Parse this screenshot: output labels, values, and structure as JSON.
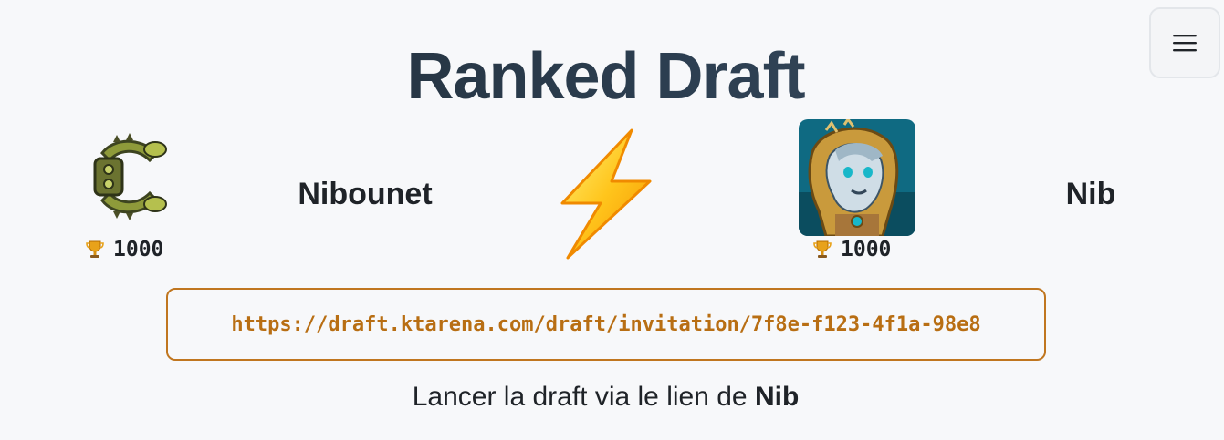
{
  "header": {
    "title": "Ranked Draft",
    "menu_icon": "hamburger-icon"
  },
  "players": [
    {
      "name": "Nibounet",
      "rating": "1000",
      "avatar": "mechanical-creature-icon"
    },
    {
      "name": "Nib",
      "rating": "1000",
      "avatar": "hooded-character-portrait"
    }
  ],
  "versus_icon": "lightning-bolt-icon",
  "invite": {
    "url": "https://draft.ktarena.com/draft/invitation/7f8e-f123-4f1a-98e8"
  },
  "launch": {
    "prefix": "Lancer la draft via le lien de ",
    "player": "Nib"
  },
  "colors": {
    "accent": "#c0761f",
    "link_text": "#b86e13",
    "title": "#2c3e50",
    "background": "#f7f8fa"
  }
}
